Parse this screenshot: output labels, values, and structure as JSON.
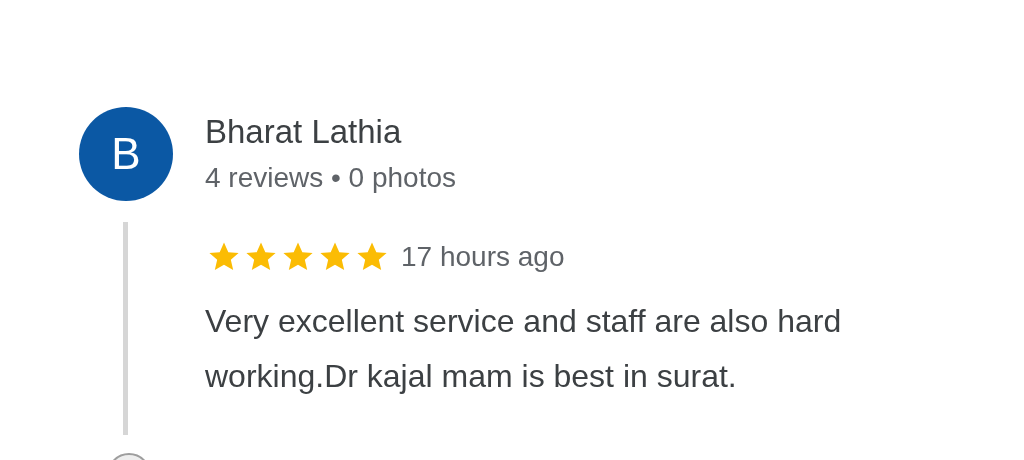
{
  "review": {
    "avatar_letter": "B",
    "author": "Bharat Lathia",
    "author_stats": "4 reviews • 0 photos",
    "stars": 5,
    "time": "17 hours ago",
    "text": "Very excellent service and staff are also hard working.Dr kajal mam is best in surat."
  }
}
